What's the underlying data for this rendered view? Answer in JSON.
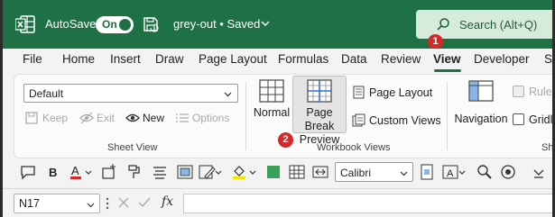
{
  "titlebar": {
    "autosave_label": "AutoSave",
    "toggle_label": "On",
    "file_title": "grey-out • Saved",
    "search_label": "Search (Alt+Q)"
  },
  "badges": {
    "first": "1",
    "second": "2"
  },
  "menu": {
    "tabs": [
      "File",
      "Home",
      "Insert",
      "Draw",
      "Page Layout",
      "Formulas",
      "Data",
      "Review",
      "View",
      "Developer",
      "S"
    ],
    "active": "View"
  },
  "sheet_view": {
    "dropdown_value": "Default",
    "keep_label": "Keep",
    "exit_label": "Exit",
    "new_label": "New",
    "options_label": "Options",
    "group_label": "Sheet View"
  },
  "workbook_views": {
    "normal_label": "Normal",
    "page_break_line1": "Page Break",
    "page_break_line2": "Preview",
    "page_layout_label": "Page Layout",
    "custom_views_label": "Custom Views",
    "group_label": "Workbook Views"
  },
  "show": {
    "navigation_label": "Navigation",
    "ruler_label": "Ruler",
    "gridlines_label": "Gridlin",
    "group_label": "Sho"
  },
  "quick_toolbar": {
    "font_value": "Calibri"
  },
  "formula_bar": {
    "name_box_value": "N17",
    "fx_label": "fx"
  },
  "colors": {
    "title_green": "#1e7145",
    "search_bg": "#d7ebdd",
    "badge_red": "#d42a2a",
    "font_color_red": "#d42a2a",
    "highlight_yellow": "#f5e400",
    "fill_green": "#3aa05c"
  }
}
